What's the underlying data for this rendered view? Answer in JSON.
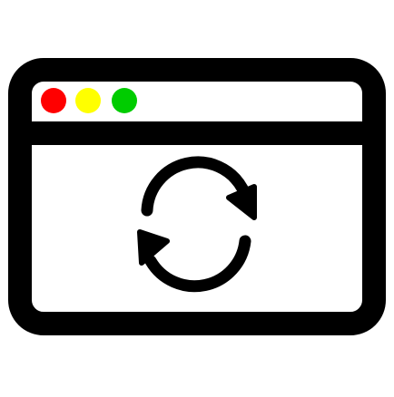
{
  "icon": {
    "name": "browser-window-refresh-icon",
    "stroke_color": "#000000",
    "background_color": "#ffffff",
    "traffic_lights": [
      {
        "name": "close-dot",
        "color": "#ff0000"
      },
      {
        "name": "minimize-dot",
        "color": "#ffff00"
      },
      {
        "name": "maximize-dot",
        "color": "#00cc00"
      }
    ],
    "center_symbol": "refresh-arrows"
  }
}
